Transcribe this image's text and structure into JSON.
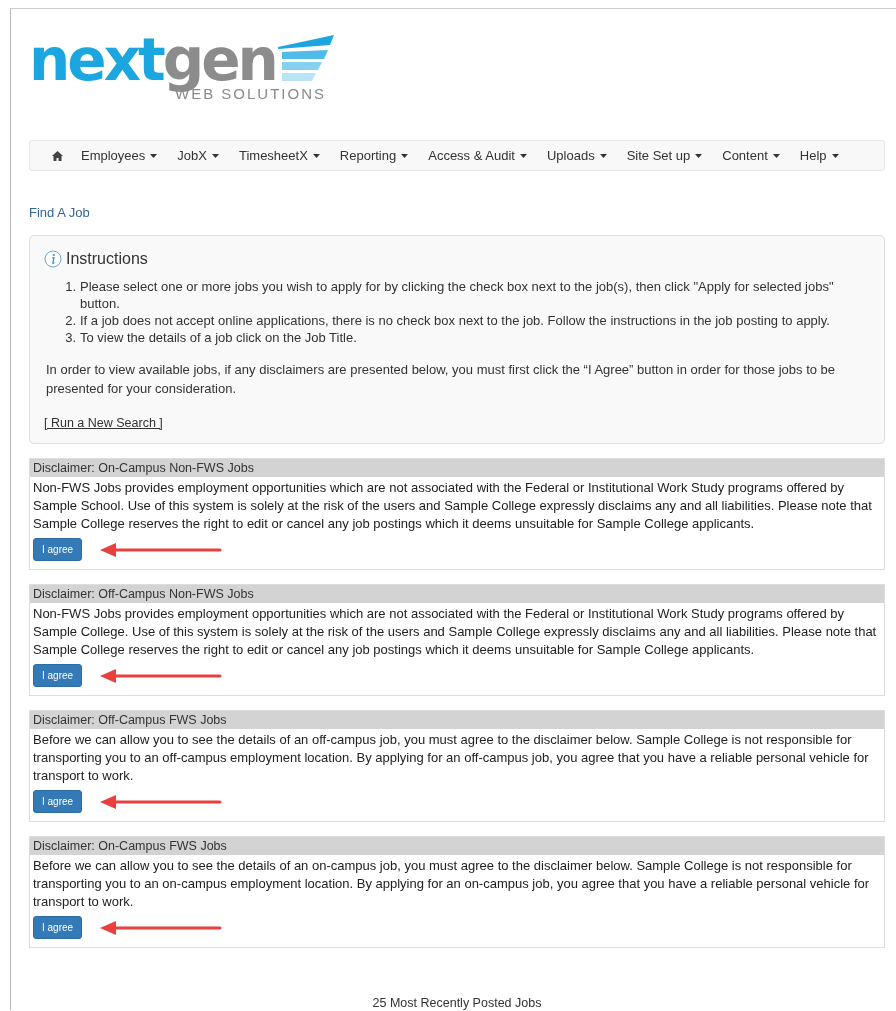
{
  "logo": {
    "word_1": "next",
    "word_2": "gen",
    "tagline": "WEB SOLUTIONS"
  },
  "nav": {
    "items": [
      {
        "label": "Employees"
      },
      {
        "label": "JobX"
      },
      {
        "label": "TimesheetX"
      },
      {
        "label": "Reporting"
      },
      {
        "label": "Access & Audit"
      },
      {
        "label": "Uploads"
      },
      {
        "label": "Site Set up"
      },
      {
        "label": "Content"
      },
      {
        "label": "Help"
      }
    ]
  },
  "page_title": "Find A Job",
  "instructions": {
    "title": "Instructions",
    "steps": [
      {
        "marker": "1.",
        "text": "Please select one or more jobs you wish to apply for by clicking the check box next to the job(s), then click \"Apply for selected jobs\" button."
      },
      {
        "marker": "2.",
        "text": "If a job does not accept online applications, there is no check box next to the job. Follow the instructions in the job posting to apply."
      },
      {
        "marker": "3.",
        "text": "To view the details of a job click on the Job Title."
      }
    ],
    "note": "In order to view available jobs, if any disclaimers are presented below, you must first click the “I Agree” button in order for those jobs to be presented for your consideration.",
    "link": "[ Run a New Search ]"
  },
  "disclaimers": [
    {
      "title": "Disclaimer: On-Campus Non-FWS Jobs",
      "text": "Non-FWS Jobs provides employment opportunities which are not associated with the Federal or Institutional Work Study programs offered by Sample School. Use of this system is solely at the risk of the users and Sample College expressly disclaims any and all liabilities. Please note that Sample College reserves the right to edit or cancel any job postings which it deems unsuitable for Sample College applicants.",
      "button": "I agree"
    },
    {
      "title": "Disclaimer: Off-Campus Non-FWS Jobs",
      "text": "Non-FWS Jobs provides employment opportunities which are not associated with the Federal or Institutional Work Study programs offered by Sample College. Use of this system is solely at the risk of the users and Sample College expressly disclaims any and all liabilities. Please note that Sample College reserves the right to edit or cancel any job postings which it deems unsuitable for Sample College applicants.",
      "button": "I agree"
    },
    {
      "title": "Disclaimer: Off-Campus FWS Jobs",
      "text": "Before we can allow you to see the details of an off-campus job, you must agree to the disclaimer below. Sample College is not responsible for transporting you to an off-campus employment location. By applying for an off-campus job, you agree that you have a reliable personal vehicle for transport to work.",
      "button": "I agree"
    },
    {
      "title": "Disclaimer: On-Campus FWS Jobs",
      "text": "Before we can allow you to see the details of an on-campus job, you must agree to the disclaimer below. Sample College is not responsible for transporting you to an on-campus employment location. By applying for an on-campus job, you agree that you have a reliable personal vehicle for transport to work.",
      "button": "I agree"
    }
  ],
  "footer_heading": "25 Most Recently Posted Jobs"
}
